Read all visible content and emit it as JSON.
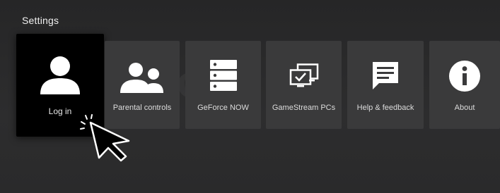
{
  "header": {
    "title": "Settings"
  },
  "tiles": [
    {
      "label": "Log in",
      "icon": "person-icon"
    },
    {
      "label": "Parental controls",
      "icon": "people-icon"
    },
    {
      "label": "GeForce NOW",
      "icon": "server-icon"
    },
    {
      "label": "GameStream PCs",
      "icon": "monitors-check-icon"
    },
    {
      "label": "Help & feedback",
      "icon": "chat-bubble-icon"
    },
    {
      "label": "About",
      "icon": "info-icon"
    }
  ],
  "colors": {
    "background": "#2b2b2c",
    "tile": "#3a3a3b",
    "selected_tile": "#000000",
    "icon": "#ffffff"
  }
}
